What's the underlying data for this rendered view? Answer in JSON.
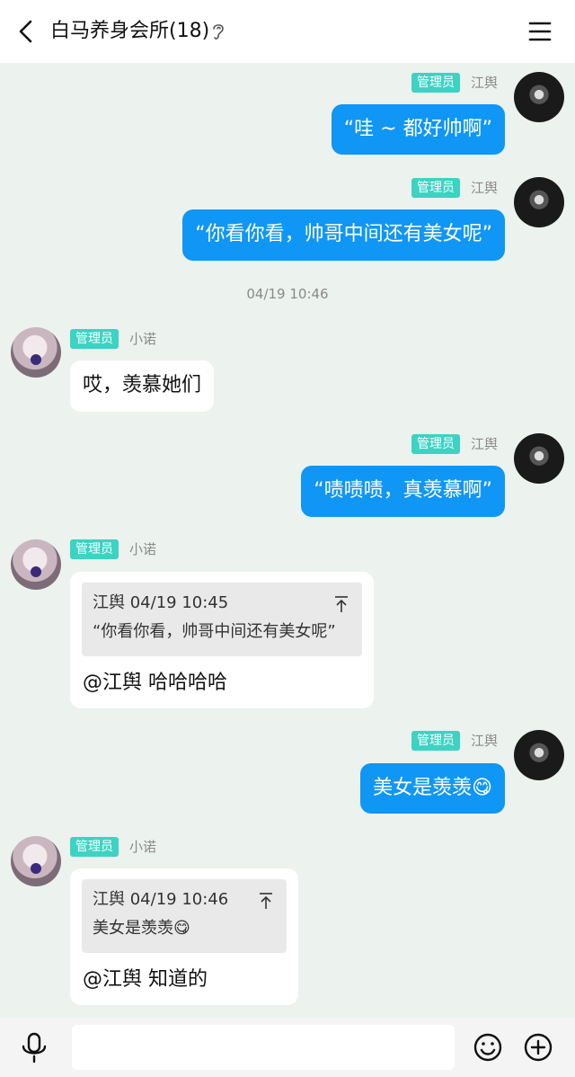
{
  "header": {
    "title": "白马养身会所(18)"
  },
  "colors": {
    "my_bubble": "#1096f5",
    "badge": "#3cd3c3",
    "background": "#ecf2ee"
  },
  "messages": [
    {
      "role_badge": "管理员",
      "sender": "江舆",
      "text": "“哇 ~ 都好帅啊”"
    },
    {
      "role_badge": "管理员",
      "sender": "江舆",
      "text": "“你看你看，帅哥中间还有美女呢”"
    },
    {
      "time": "04/19 10:46"
    },
    {
      "role_badge": "管理员",
      "sender": "小诺",
      "text": "哎，羡慕她们"
    },
    {
      "role_badge": "管理员",
      "sender": "江舆",
      "text": "“啧啧啧，真羡慕啊”"
    },
    {
      "role_badge": "管理员",
      "sender": "小诺",
      "quote": {
        "meta": "江舆 04/19 10:45",
        "text": "“你看你看，帅哥中间还有美女呢”"
      },
      "text": "@江舆 哈哈哈哈"
    },
    {
      "role_badge": "管理员",
      "sender": "江舆",
      "text": "美女是羡羡😋"
    },
    {
      "role_badge": "管理员",
      "sender": "小诺",
      "quote": {
        "meta": "江舆 04/19 10:46",
        "text": "美女是羡羡😋"
      },
      "text": "@江舆 知道的"
    }
  ],
  "input": {
    "placeholder": ""
  }
}
